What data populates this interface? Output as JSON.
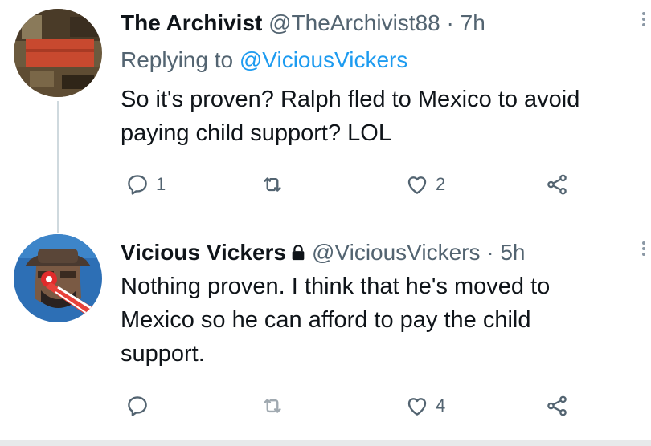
{
  "tweets": [
    {
      "author_name": "The Archivist",
      "handle": "@TheArchivist88",
      "separator": "·",
      "time": "7h",
      "replying_prefix": "Replying to",
      "replying_to": "@ViciousVickers",
      "text_lines": [
        "So it's proven? Ralph fled to Mexico to avoid",
        "paying child support? LOL"
      ],
      "reply_count": "1",
      "retweet_count": "",
      "like_count": "2"
    },
    {
      "author_name": "Vicious Vickers",
      "handle": "@ViciousVickers",
      "separator": "·",
      "time": "5h",
      "text_lines": [
        "Nothing proven. I think that he's moved to",
        "Mexico so he can afford to pay the child",
        "support."
      ],
      "reply_count": "",
      "retweet_count": "",
      "like_count": "4"
    }
  ],
  "icons": {
    "reply": "reply-icon",
    "retweet": "retweet-icon",
    "like": "heart-icon",
    "share": "share-icon",
    "lock": "lock-icon",
    "more": "more-icon"
  },
  "colors": {
    "link": "#1d9bf0",
    "secondary_text": "#536471",
    "primary_text": "#0f1419",
    "thread_line": "#cfd9de"
  }
}
